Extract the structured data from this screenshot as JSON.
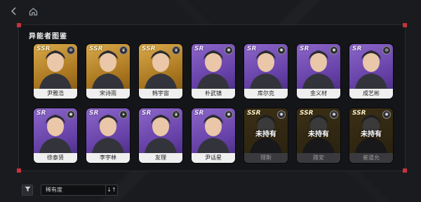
{
  "header": {
    "back_icon": "back-arrow-icon",
    "home_icon": "home-icon"
  },
  "panel": {
    "title": "异能者图鉴",
    "accent_color": "#c8323c"
  },
  "characters": [
    {
      "name": "尹雅浩",
      "rarity": "SSR",
      "owned": true,
      "element": "gear"
    },
    {
      "name": "宋诗雨",
      "rarity": "SSR",
      "owned": true,
      "element": "leaf"
    },
    {
      "name": "韩宇宙",
      "rarity": "SSR",
      "owned": true,
      "element": "leaf"
    },
    {
      "name": "朴武镇",
      "rarity": "SR",
      "owned": true,
      "element": "fire"
    },
    {
      "name": "库尔克",
      "rarity": "SR",
      "owned": true,
      "element": "fire"
    },
    {
      "name": "金义材",
      "rarity": "SR",
      "owned": true,
      "element": "fire"
    },
    {
      "name": "成艺彬",
      "rarity": "SR",
      "owned": true,
      "element": "gear"
    },
    {
      "name": "徐泰贤",
      "rarity": "SR",
      "owned": true,
      "element": "fire"
    },
    {
      "name": "李宇林",
      "rarity": "SR",
      "owned": true,
      "element": "star"
    },
    {
      "name": "友理",
      "rarity": "SR",
      "owned": true,
      "element": "leaf"
    },
    {
      "name": "尹话星",
      "rarity": "SR",
      "owned": true,
      "element": "fire"
    },
    {
      "name": "理斯",
      "rarity": "SSR",
      "owned": false,
      "element": "fire"
    },
    {
      "name": "路安",
      "rarity": "SSR",
      "owned": false,
      "element": "fire"
    },
    {
      "name": "崔道允",
      "rarity": "SSR",
      "owned": false,
      "element": "fire"
    }
  ],
  "not_owned_label": "未持有",
  "footer": {
    "sort_label": "稀有度",
    "filter_icon": "filter-icon",
    "sort_order_icon": "sort-order-icon"
  }
}
